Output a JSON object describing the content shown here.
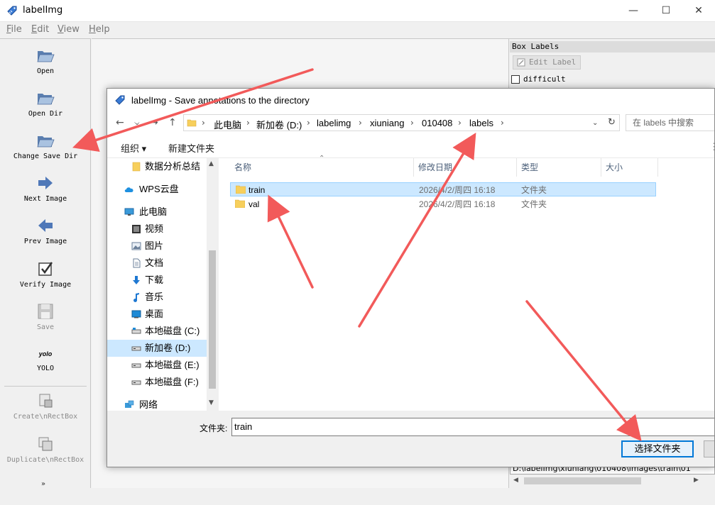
{
  "window": {
    "title": "labelImg"
  },
  "menu": [
    "File",
    "Edit",
    "View",
    "Help"
  ],
  "toolbar": [
    {
      "label": "Open",
      "icon": "folder-open-icon",
      "enabled": true
    },
    {
      "label": "Open Dir",
      "icon": "folder-open-icon",
      "enabled": true
    },
    {
      "label": "Change Save Dir",
      "icon": "folder-open-icon",
      "enabled": true
    },
    {
      "label": "Next Image",
      "icon": "arrow-right-icon",
      "enabled": true
    },
    {
      "label": "Prev Image",
      "icon": "arrow-left-icon",
      "enabled": true
    },
    {
      "label": "Verify Image",
      "icon": "checkbox-icon",
      "enabled": true
    },
    {
      "label": "Save",
      "icon": "floppy-disk-icon",
      "enabled": false
    },
    {
      "label": "YOLO",
      "icon_text": "yolo",
      "enabled": true
    },
    {
      "label": "Create\\nRectBox",
      "icon": "create-rect-icon",
      "enabled": false
    },
    {
      "label": "Duplicate\\nRectBox",
      "icon": "duplicate-rect-icon",
      "enabled": false
    }
  ],
  "dock": {
    "header": "Box Labels",
    "edit_label": "Edit Label",
    "difficult": "difficult",
    "path": "D:\\labelImg\\xiuniang\\010408\\images\\train\\01"
  },
  "dialog": {
    "title": "labelImg - Save annotations to the directory",
    "breadcrumb": [
      "此电脑",
      "新加卷 (D:)",
      "labelimg",
      "xiuniang",
      "010408",
      "labels"
    ],
    "search_placeholder": "在 labels 中搜索",
    "organize": "组织 ▾",
    "new_folder": "新建文件夹",
    "nav_items": [
      {
        "label": "数据分析总结",
        "icon": "folder-icon"
      },
      {
        "label": "WPS云盘",
        "icon": "cloud-icon"
      },
      {
        "label": "此电脑",
        "icon": "computer-icon"
      },
      {
        "label": "视频",
        "icon": "video-icon"
      },
      {
        "label": "图片",
        "icon": "picture-icon"
      },
      {
        "label": "文档",
        "icon": "document-icon"
      },
      {
        "label": "下载",
        "icon": "download-icon"
      },
      {
        "label": "音乐",
        "icon": "music-icon"
      },
      {
        "label": "桌面",
        "icon": "desktop-icon"
      },
      {
        "label": "本地磁盘 (C:)",
        "icon": "drive-icon"
      },
      {
        "label": "新加卷 (D:)",
        "icon": "drive-icon",
        "selected": true
      },
      {
        "label": "本地磁盘 (E:)",
        "icon": "drive-icon"
      },
      {
        "label": "本地磁盘 (F:)",
        "icon": "drive-icon"
      },
      {
        "label": "网络",
        "icon": "network-icon"
      }
    ],
    "columns": [
      "名称",
      "修改日期",
      "类型",
      "大小"
    ],
    "files": [
      {
        "name": "train",
        "date": "2026/4/2/周四 16:18",
        "type": "文件夹",
        "selected": true
      },
      {
        "name": "val",
        "date": "2026/4/2/周四 16:18",
        "type": "文件夹"
      }
    ],
    "folder_label": "文件夹:",
    "folder_value": "train",
    "select_button": "选择文件夹"
  }
}
